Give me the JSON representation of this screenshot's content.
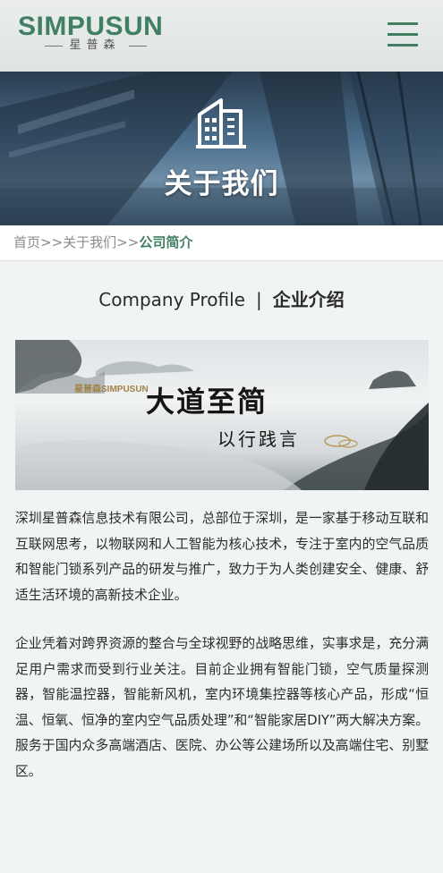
{
  "header": {
    "logo_text": "SIMPUSUN",
    "logo_sub": "星普森",
    "menu_icon": "hamburger-menu-icon"
  },
  "banner": {
    "icon": "building-icon",
    "title": "关于我们"
  },
  "breadcrumb": {
    "items": [
      "首页",
      "关于我们"
    ],
    "separator": ">>",
    "current": "公司简介"
  },
  "section": {
    "title_en": "Company Profile",
    "separator": "|",
    "title_cn": "企业介绍"
  },
  "image": {
    "brand_cn": "星普森",
    "brand_en": "SIMPUSUN",
    "line1": "大道至简",
    "line2": "以行践言"
  },
  "content": {
    "paragraphs": [
      "深圳星普森信息技术有限公司，总部位于深圳，是一家基于移动互联和互联网思考，以物联网和人工智能为核心技术，专注于室内的空气品质和智能门锁系列产品的研发与推广，致力于为人类创建安全、健康、舒适生活环境的高新技术企业。",
      "企业凭着对跨界资源的整合与全球视野的战略思维，实事求是，充分满足用户需求而受到行业关注。目前企业拥有智能门锁，空气质量探测器，智能温控器，智能新风机，室内环境集控器等核心产品，形成“恒温、恒氧、恒净的室内空气品质处理”和“智能家居DIY”两大解决方案。服务于国内众多高端酒店、医院、办公等公建场所以及高端住宅、别墅区。"
    ]
  },
  "colors": {
    "brand_green": "#3f7f62",
    "text": "#2c2c2c",
    "breadcrumb_gray": "#8a8a8a"
  }
}
